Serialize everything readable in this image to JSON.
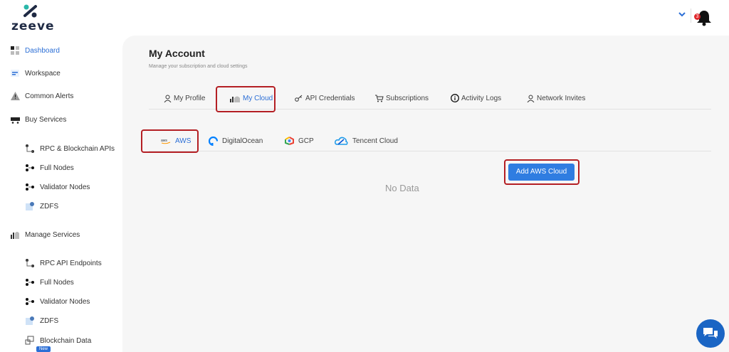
{
  "brand": {
    "name": "zeeve",
    "colors": {
      "accent": "#2c6fd6",
      "button": "#2f7de1",
      "highlight": "#b41f24"
    }
  },
  "sidebar": {
    "items": [
      {
        "label": "Dashboard",
        "icon": "dashboard-icon",
        "active": true
      },
      {
        "label": "Workspace",
        "icon": "workspace-icon"
      },
      {
        "label": "Common Alerts",
        "icon": "alert-icon"
      },
      {
        "label": "Buy Services",
        "icon": "cart-icon"
      },
      {
        "label": "Manage Services",
        "icon": "manage-icon"
      }
    ],
    "buy_sub": [
      {
        "label": "RPC & Blockchain APIs",
        "icon": "rpc-icon"
      },
      {
        "label": "Full Nodes",
        "icon": "node-icon"
      },
      {
        "label": "Validator Nodes",
        "icon": "node-icon"
      },
      {
        "label": "ZDFS",
        "icon": "zdfs-icon"
      }
    ],
    "manage_sub": [
      {
        "label": "RPC API Endpoints",
        "icon": "rpc-icon"
      },
      {
        "label": "Full Nodes",
        "icon": "node-icon"
      },
      {
        "label": "Validator Nodes",
        "icon": "node-icon"
      },
      {
        "label": "ZDFS",
        "icon": "zdfs-icon"
      },
      {
        "label": "Blockchain Data",
        "icon": "data-icon"
      }
    ],
    "new_badge": "New"
  },
  "header": {
    "notification_count": "3"
  },
  "account": {
    "title": "My Account",
    "subtitle": "Manage your subscription and cloud settings",
    "tabs": [
      {
        "label": "My Profile",
        "icon": "user-icon"
      },
      {
        "label": "My Cloud",
        "icon": "cloud-icon",
        "active": true
      },
      {
        "label": "API Credentials",
        "icon": "key-icon"
      },
      {
        "label": "Subscriptions",
        "icon": "cart-icon"
      },
      {
        "label": "Activity Logs",
        "icon": "info-icon"
      },
      {
        "label": "Network Invites",
        "icon": "user-icon"
      }
    ],
    "cloud_tabs": [
      {
        "label": "AWS",
        "icon": "aws-icon",
        "active": true
      },
      {
        "label": "DigitalOcean",
        "icon": "digitalocean-icon"
      },
      {
        "label": "GCP",
        "icon": "gcp-icon"
      },
      {
        "label": "Tencent Cloud",
        "icon": "tencent-icon"
      }
    ],
    "add_button": "Add AWS Cloud",
    "empty_text": "No Data"
  }
}
